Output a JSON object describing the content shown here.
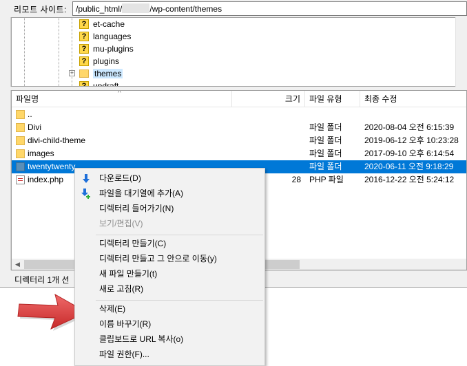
{
  "remote_site": {
    "label": "리모트 사이트:",
    "path_prefix": "/public_html/",
    "path_suffix": "/wp-content/themes"
  },
  "tree": {
    "items": [
      {
        "label": "et-cache",
        "icon": "unknown-folder-icon"
      },
      {
        "label": "languages",
        "icon": "unknown-folder-icon"
      },
      {
        "label": "mu-plugins",
        "icon": "unknown-folder-icon"
      },
      {
        "label": "plugins",
        "icon": "unknown-folder-icon"
      },
      {
        "label": "themes",
        "icon": "folder-icon",
        "selected": true
      },
      {
        "label": "updraft",
        "icon": "unknown-folder-icon"
      }
    ],
    "expander_glyph": "⊞"
  },
  "file_list": {
    "columns": {
      "name": "파일명",
      "size": "크기",
      "type": "파일 유형",
      "modified": "최종 수정"
    },
    "sort_glyph": "^",
    "rows": [
      {
        "name": "..",
        "size": "",
        "type": "",
        "modified": "",
        "icon": "folder-icon"
      },
      {
        "name": "Divi",
        "size": "",
        "type": "파일 폴더",
        "modified": "2020-08-04 오전 6:15:39",
        "icon": "folder-icon"
      },
      {
        "name": "divi-child-theme",
        "size": "",
        "type": "파일 폴더",
        "modified": "2019-06-12 오후 10:23:28",
        "icon": "folder-icon"
      },
      {
        "name": "images",
        "size": "",
        "type": "파일 폴더",
        "modified": "2017-09-10 오후 6:14:54",
        "icon": "folder-icon"
      },
      {
        "name": "twentytwenty",
        "size": "",
        "type": "파일 폴더",
        "modified": "2020-06-11 오전 9:18:29",
        "icon": "folder-icon",
        "selected": true
      },
      {
        "name": "index.php",
        "size": "28",
        "type": "PHP 파일",
        "modified": "2016-12-22 오전 5:24:12",
        "icon": "php-file-icon"
      }
    ]
  },
  "status": {
    "text": "디렉터리 1개 선"
  },
  "context_menu": {
    "items": [
      {
        "label": "다운로드(D)",
        "icon": "download-icon"
      },
      {
        "label": "파일을 대기열에 추가(A)",
        "icon": "add-to-queue-icon"
      },
      {
        "label": "디렉터리 들어가기(N)"
      },
      {
        "label": "보기/편집(V)",
        "disabled": true
      },
      {
        "label": "디렉터리 만들기(C)"
      },
      {
        "label": "디렉터리 만들고 그 안으로 이동(y)"
      },
      {
        "label": "새 파일 만들기(t)"
      },
      {
        "label": "새로 고침(R)"
      },
      {
        "label": "삭제(E)"
      },
      {
        "label": "이름 바꾸기(R)"
      },
      {
        "label": "클립보드로 URL 복사(o)"
      },
      {
        "label": "파일 권한(F)..."
      }
    ]
  },
  "colors": {
    "selection": "#0078d7",
    "folder": "#ffd769",
    "arrow": "#e03a3a",
    "download_arrow": "#1e6fd9",
    "queue_plus": "#2fae3a"
  }
}
